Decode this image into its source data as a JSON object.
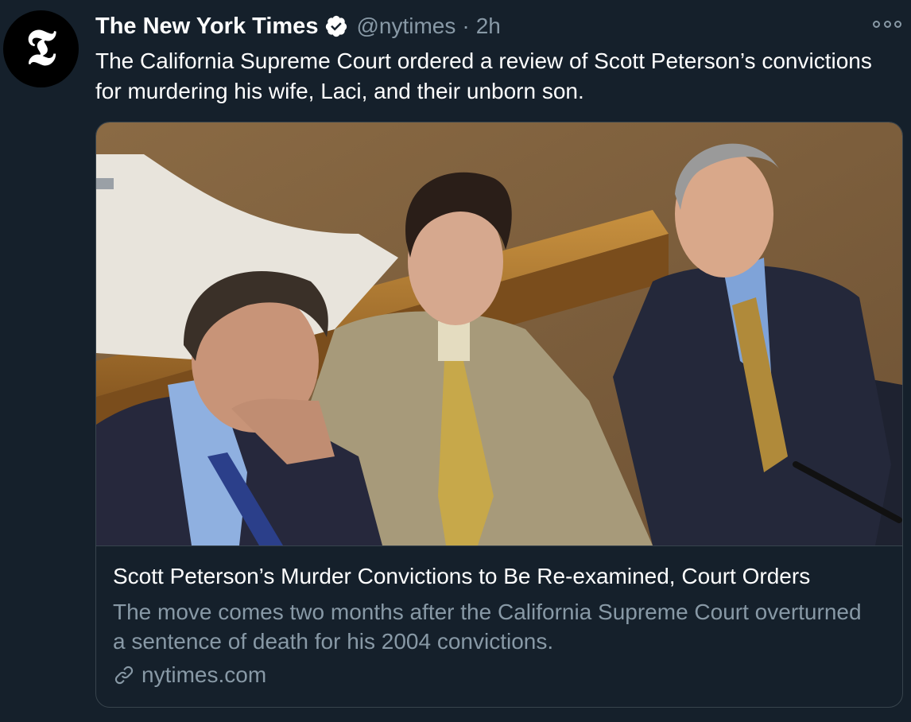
{
  "tweet": {
    "avatar_glyph": "𝕿",
    "display_name": "The New York Times",
    "handle": "@nytimes",
    "separator": "·",
    "time": "2h",
    "text": "The California Supreme Court ordered a review of Scott Peterson’s convictions for murdering his wife, Laci, and their unborn son."
  },
  "card": {
    "title": "Scott Peterson’s Murder Convictions to Be Re-examined, Court Orders",
    "description": "The move comes two months after the California Supreme Court overturned a sentence of death for his 2004 convictions.",
    "domain": "nytimes.com"
  },
  "colors": {
    "background": "#15202b",
    "secondary_text": "#8899a6",
    "border": "#38444d",
    "verified": "#ffffff"
  },
  "icons": {
    "verified": "verified-badge-icon",
    "more": "more-options-icon",
    "link": "link-icon"
  }
}
